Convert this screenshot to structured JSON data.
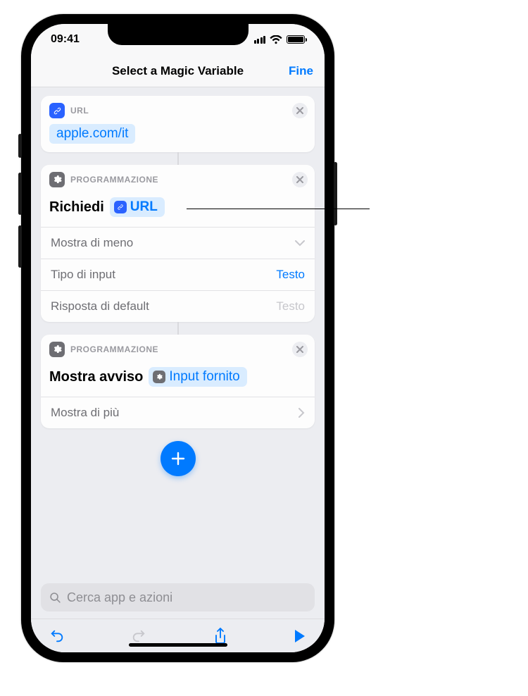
{
  "status": {
    "time": "09:41"
  },
  "nav": {
    "title": "Select a Magic Variable",
    "done": "Fine"
  },
  "url_card": {
    "category": "URL",
    "value": "apple.com/it"
  },
  "request_card": {
    "category": "PROGRAMMAZIONE",
    "action": "Richiedi",
    "token": "URL",
    "show_less": "Mostra di meno",
    "row1": {
      "label": "Tipo di input",
      "value": "Testo"
    },
    "row2": {
      "label": "Risposta di default",
      "placeholder": "Testo"
    }
  },
  "alert_card": {
    "category": "PROGRAMMAZIONE",
    "action": "Mostra avviso",
    "token": "Input fornito",
    "show_more": "Mostra di più"
  },
  "search": {
    "placeholder": "Cerca app e azioni"
  }
}
